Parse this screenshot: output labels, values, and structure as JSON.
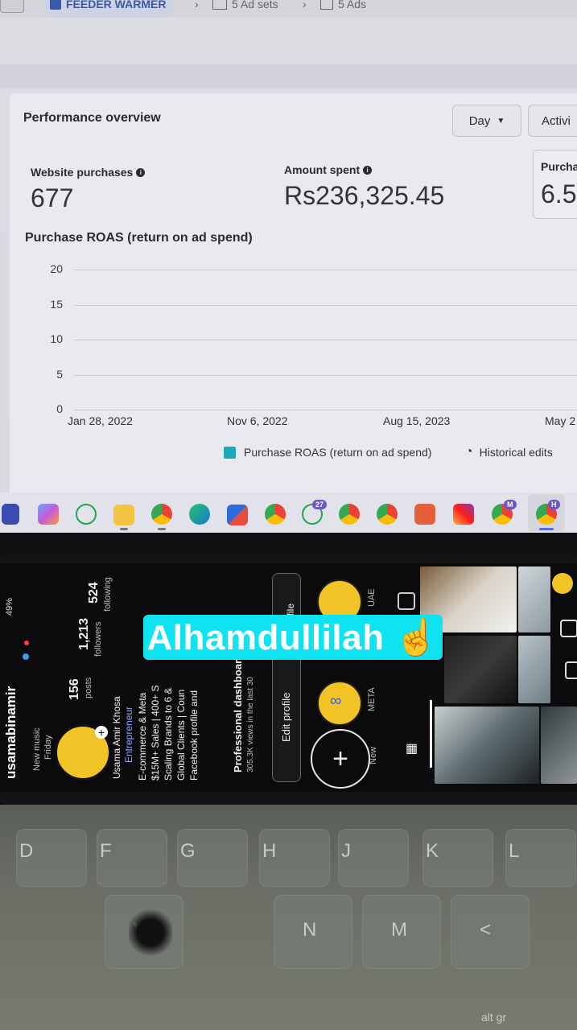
{
  "breadcrumb": {
    "campaign": "FEEDER WARMER",
    "ad_sets": "5 Ad sets",
    "ads": "5 Ads"
  },
  "card": {
    "title": "Performance overview",
    "period_button": "Day",
    "activity_button": "Activi"
  },
  "metrics": [
    {
      "label": "Website purchases",
      "value": "677"
    },
    {
      "label": "Amount spent",
      "value": "Rs236,325.45"
    },
    {
      "label": "Purcha",
      "value": "6.5"
    }
  ],
  "chart_data": {
    "type": "line",
    "title": "Purchase ROAS (return on ad spend)",
    "y_ticks": [
      "20",
      "15",
      "10",
      "5",
      "0"
    ],
    "ylim": [
      0,
      20
    ],
    "x_ticks": [
      "Jan 28, 2022",
      "Nov 6, 2022",
      "Aug 15, 2023",
      "May 2"
    ],
    "series": [
      {
        "name": "Purchase ROAS (return on ad spend)",
        "color": "#20a7b5",
        "values": []
      }
    ],
    "grid": true,
    "legend_position": "bottom"
  },
  "legend": {
    "series_label": "Purchase ROAS (return on ad spend)",
    "historical_label": "Historical edits"
  },
  "taskbar": {
    "whatsapp_badge": "27",
    "profile_m": "M",
    "profile_h": "H"
  },
  "phone": {
    "status": "49%",
    "username": "usamabinamir",
    "highlight_new_music": "New music",
    "highlight_new_music_sub": "Friday",
    "posts_count": "156",
    "posts_label": "posts",
    "followers_count": "1,213",
    "followers_label": "followers",
    "following_count": "524",
    "following_label": "following",
    "bio_name": "Usama Amir Khosa",
    "bio_role": "Entrepreneur",
    "bio_lines": [
      "E-commerce & Meta",
      "$15M+ Sales | 400+ S",
      "Scaling Brands to 6 &",
      "Global Clients | Coun",
      "Facebook profile and"
    ],
    "dashboard_title": "Professional dashboar",
    "dashboard_sub": "305.3K views in the last 30",
    "edit_profile": "Edit profile",
    "share_profile": "rofile",
    "hl_uae": "UAE",
    "hl_meta": "META",
    "hl_new": "New"
  },
  "sticker": {
    "text": "Alhamdullilah ☝"
  },
  "keyboard": {
    "row1": [
      "D",
      "F",
      "G",
      "H",
      "J",
      "K",
      "L"
    ],
    "row2": [
      "V",
      "N",
      "M",
      "<"
    ],
    "alt_label": "alt gr"
  }
}
